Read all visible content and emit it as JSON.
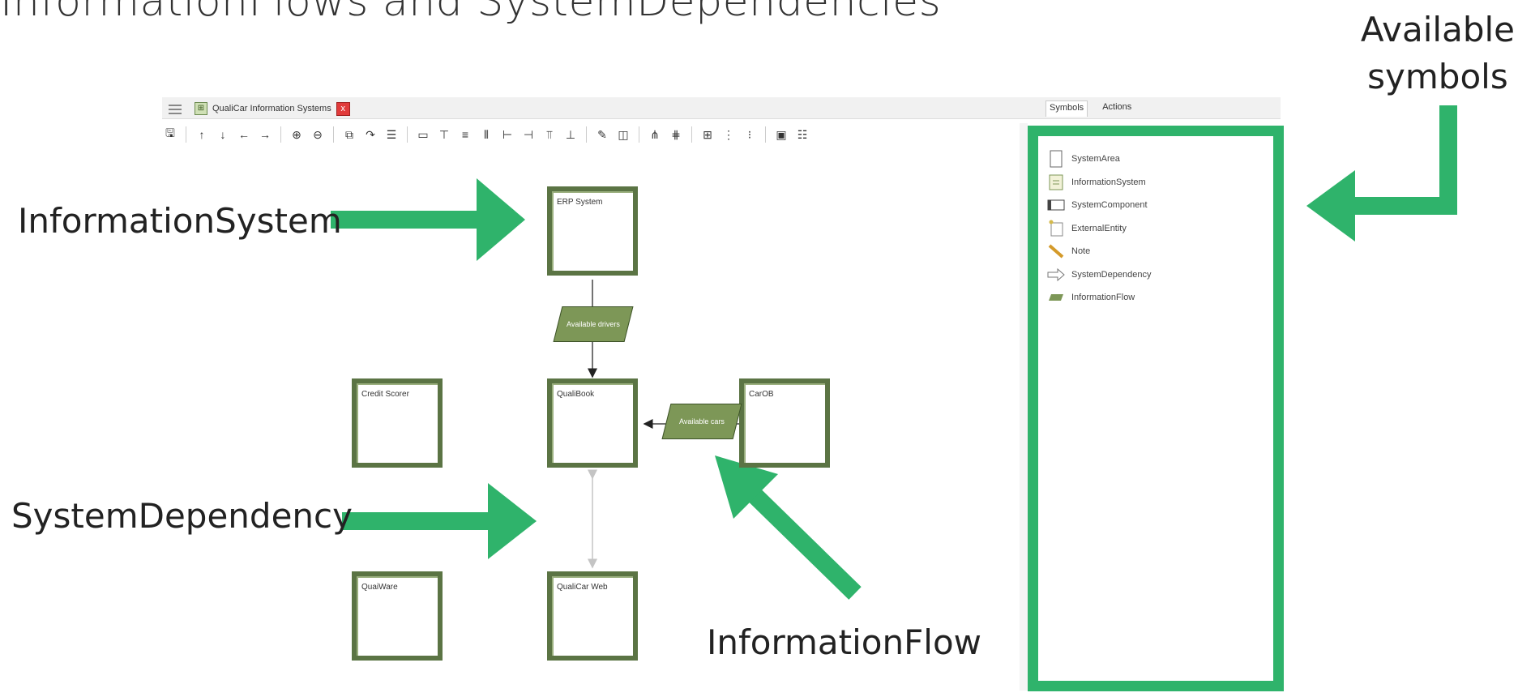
{
  "slide_title": "InformationFlows and SystemDependencies",
  "callouts": {
    "available_line1": "Available",
    "available_line2": "symbols",
    "information_system": "InformationSystem",
    "system_dependency": "SystemDependency",
    "information_flow": "InformationFlow"
  },
  "app": {
    "tab_title": "QualiCar Information Systems",
    "tab_close": "x"
  },
  "panel": {
    "tabs": [
      "Symbols",
      "Actions"
    ],
    "symbols": [
      "SystemArea",
      "InformationSystem",
      "SystemComponent",
      "ExternalEntity",
      "Note",
      "SystemDependency",
      "InformationFlow"
    ]
  },
  "diagram": {
    "systems": {
      "erp": "ERP System",
      "credit": "Credit Scorer",
      "qualibook": "QualiBook",
      "carob": "CarOB",
      "quaiware": "QuaiWare",
      "qualicar_web": "QualiCar Web"
    },
    "flows": {
      "drivers": "Available drivers",
      "cars": "Available cars"
    }
  },
  "colors": {
    "accent_green": "#2fb36b",
    "system_border": "#5b7444",
    "flow_fill": "#7d9757",
    "close_red": "#e13b3b"
  }
}
